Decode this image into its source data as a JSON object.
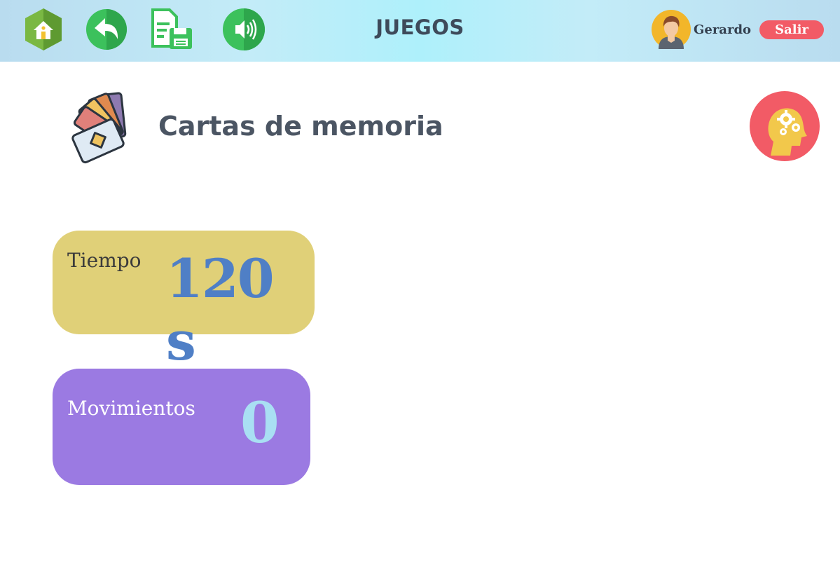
{
  "header": {
    "title": "JUEGOS",
    "icons": [
      "home-icon",
      "back-icon",
      "save-document-icon",
      "sound-icon"
    ],
    "user": {
      "name": "Gerardo",
      "logout_label": "Salir"
    }
  },
  "game": {
    "title": "Cartas de memoria",
    "icon": "memory-cards-icon",
    "settings_icon": "brain-gears-icon"
  },
  "stats": {
    "time": {
      "label": "Tiempo",
      "value": "120 s"
    },
    "moves": {
      "label": "Movimientos",
      "value": "0"
    }
  },
  "colors": {
    "topbar": "#aef0fb",
    "time_card": "#e0d078",
    "moves_card": "#9b7ae2",
    "time_value": "#4f7fc6",
    "moves_value": "#a9dff3",
    "logout_button": "#f25b66",
    "brain_button": "#f25b66"
  }
}
